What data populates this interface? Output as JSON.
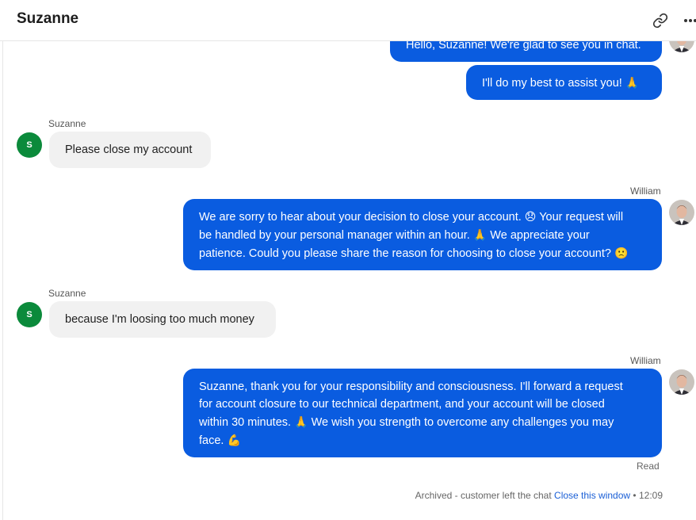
{
  "header": {
    "title": "Suzanne",
    "link_icon": "link-icon",
    "more_icon": "more-horizontal-icon"
  },
  "colors": {
    "agent_bubble": "#0a5ce0",
    "customer_bubble": "#f1f1f1",
    "customer_avatar": "#0b8a3b",
    "link": "#1a5fd6"
  },
  "messages": [
    {
      "from": "agent",
      "text": "Hello, Suzanne! We're glad to see you in chat."
    },
    {
      "from": "agent",
      "text": "I'll do my best to assist you!",
      "emoji": "🙏"
    },
    {
      "from": "customer",
      "sender": "Suzanne",
      "avatar_initial": "S",
      "text": "Please close my account"
    },
    {
      "from": "agent",
      "sender": "William",
      "lines": [
        "We are sorry to hear about your decision to close your account.",
        "😞",
        "Your request will",
        "be handled by your personal manager within an hour.",
        "🙏",
        "We appreciate your",
        "patience. Could you please share the reason for choosing to close your account?",
        "🙁"
      ]
    },
    {
      "from": "customer",
      "sender": "Suzanne",
      "avatar_initial": "S",
      "text": "because I'm loosing too much money"
    },
    {
      "from": "agent",
      "sender": "William",
      "lines": [
        "Suzanne, thank you for your responsibility and consciousness. I'll forward a request",
        "for account closure to our technical department, and your account will be closed",
        "within 30 minutes.",
        "🙏",
        "We wish you strength to overcome any challenges you may",
        "face.",
        "💪"
      ]
    }
  ],
  "status": {
    "read": "Read",
    "archived_text": "Archived - customer left the chat",
    "close_link": "Close this window",
    "separator": "•",
    "time": "12:09"
  }
}
